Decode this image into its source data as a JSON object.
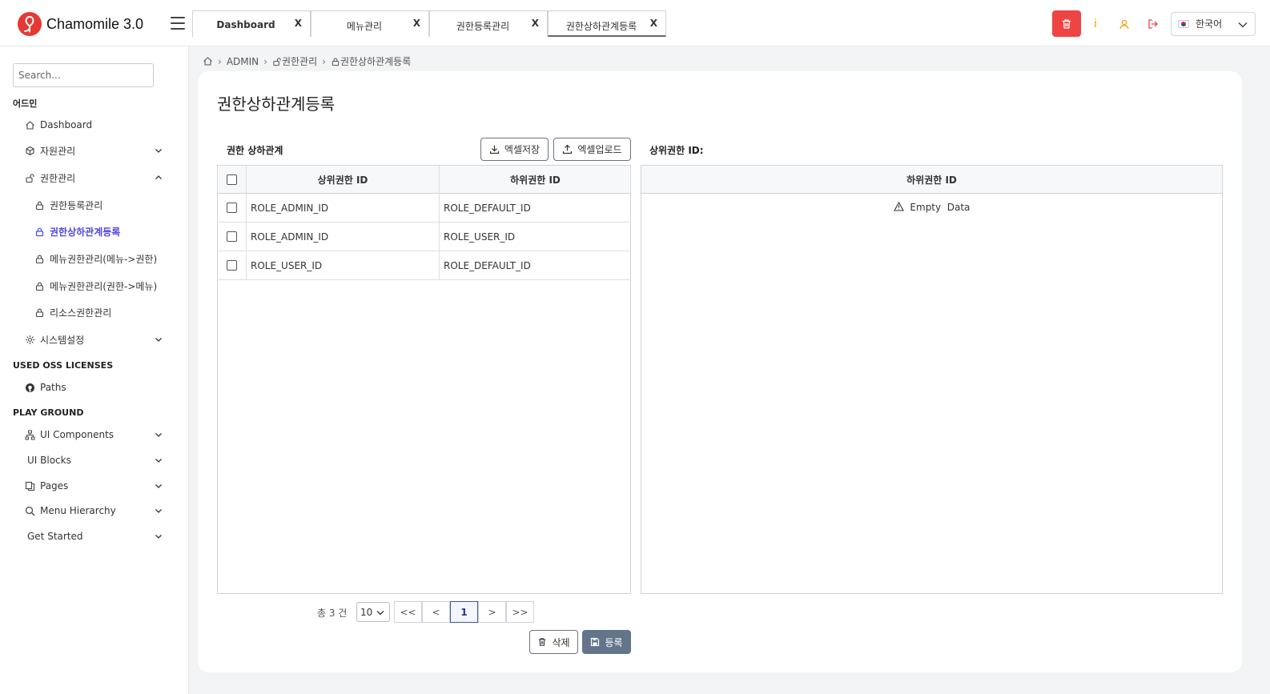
{
  "app": {
    "title": "Chamomile 3.0"
  },
  "tabs": [
    {
      "label": "Dashboard",
      "close": "X"
    },
    {
      "label": "메뉴관리",
      "close": "X"
    },
    {
      "label": "권한등록관리",
      "close": "X"
    },
    {
      "label": "권한상하관계등록",
      "close": "X"
    }
  ],
  "header": {
    "info": "i",
    "language": "한국어"
  },
  "sidebar": {
    "search_placeholder": "Search...",
    "section_admin": "어드민",
    "dashboard": "Dashboard",
    "resource": "자원관리",
    "auth": "권한관리",
    "auth_reg": "권한등록관리",
    "auth_hier": "권한상하관계등록",
    "menu_auth1": "메뉴권한관리(메뉴->권한)",
    "menu_auth2": "메뉴권한관리(권한->메뉴)",
    "res_auth": "리소스권한관리",
    "system": "시스템설정",
    "section_oss": "USED OSS LICENSES",
    "paths": "Paths",
    "section_play": "PLAY GROUND",
    "ui_components": "UI Components",
    "ui_blocks": "UI Blocks",
    "pages": "Pages",
    "menu_hierarchy": "Menu Hierarchy",
    "get_started": "Get Started"
  },
  "breadcrumb": {
    "home": "",
    "admin": "ADMIN",
    "auth": "권한관리",
    "current": "권한상하관계등록"
  },
  "page": {
    "title": "권한상하관계등록"
  },
  "left_grid": {
    "title": "권한 상하관계",
    "excel_save": "엑셀저장",
    "excel_upload": "엑셀업로드",
    "col_parent": "상위권한 ID",
    "col_child": "하위권한 ID",
    "rows": [
      {
        "parent": "ROLE_ADMIN_ID",
        "child": "ROLE_DEFAULT_ID"
      },
      {
        "parent": "ROLE_ADMIN_ID",
        "child": "ROLE_USER_ID"
      },
      {
        "parent": "ROLE_USER_ID",
        "child": "ROLE_DEFAULT_ID"
      }
    ]
  },
  "right_grid": {
    "title": "상위권한 ID:",
    "col_child": "하위권한 ID",
    "empty": "Empty  Data"
  },
  "pager": {
    "total": "총 3 건",
    "page_size": "10",
    "first": "<<",
    "prev": "<",
    "current": "1",
    "next": ">",
    "last": ">>"
  },
  "actions": {
    "delete": "삭제",
    "save": "등록"
  },
  "colors": {
    "accent": "#4f46e5",
    "danger": "#ef4444",
    "warning": "#f59e0b",
    "save_btn": "#64748b"
  }
}
